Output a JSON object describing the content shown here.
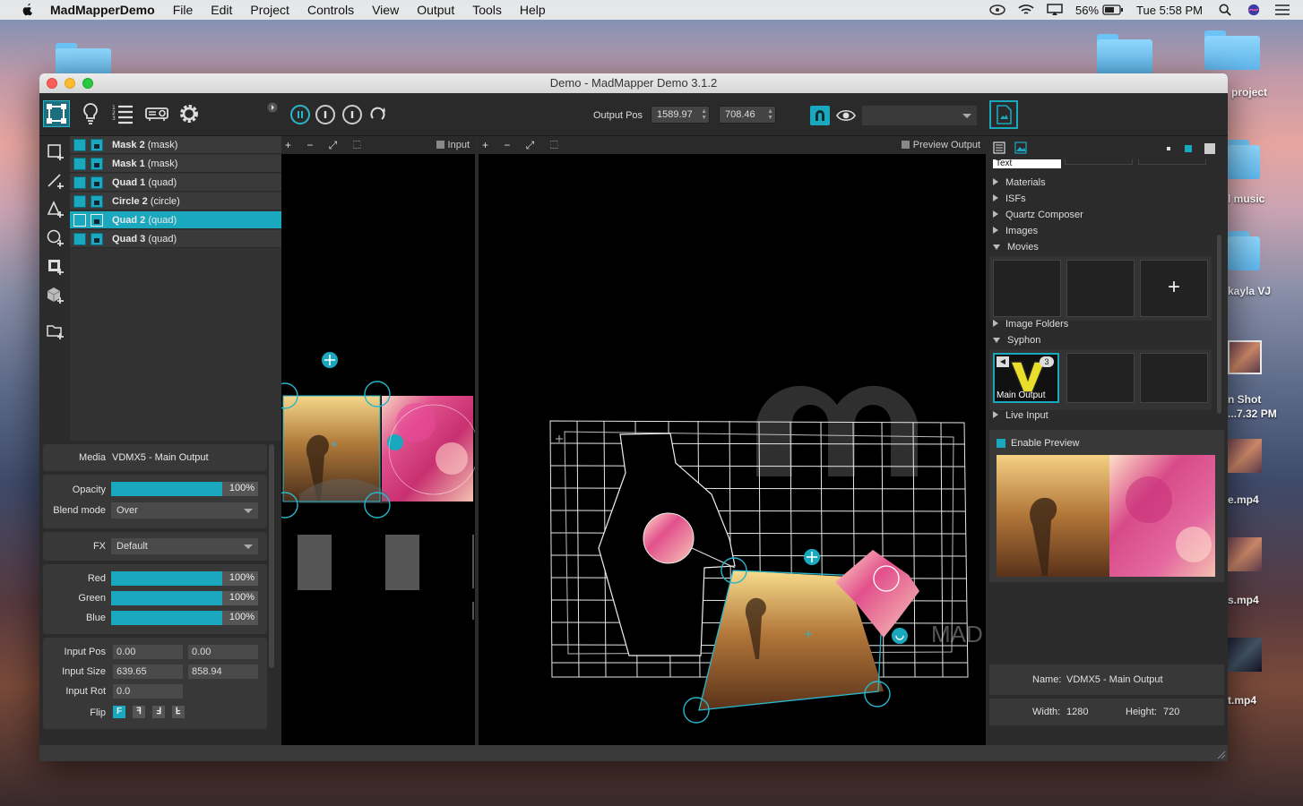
{
  "menubar": {
    "app_name": "MadMapperDemo",
    "items": [
      "File",
      "Edit",
      "Project",
      "Controls",
      "View",
      "Output",
      "Tools",
      "Help"
    ],
    "battery": "56%",
    "clock": "Tue 5:58 PM"
  },
  "desktop": {
    "labels": [
      "project",
      "l music",
      "kayla VJ",
      "n Shot",
      "...7.32 PM",
      "e.mp4",
      "s.mp4",
      "t.mp4"
    ]
  },
  "window": {
    "title": "Demo - MadMapper Demo 3.1.2"
  },
  "toolbar": {
    "output_pos_label": "Output Pos",
    "output_pos_x": "1589.97",
    "output_pos_y": "708.46",
    "output_select": ""
  },
  "surfaces": [
    {
      "name": "Mask 2",
      "type": "(mask)"
    },
    {
      "name": "Mask 1",
      "type": "(mask)"
    },
    {
      "name": "Quad 1",
      "type": "(quad)"
    },
    {
      "name": "Circle 2",
      "type": "(circle)"
    },
    {
      "name": "Quad 2",
      "type": "(quad)"
    },
    {
      "name": "Quad 3",
      "type": "(quad)"
    }
  ],
  "properties": {
    "media_label": "Media",
    "media_value": "VDMX5 - Main Output",
    "opacity_label": "Opacity",
    "opacity_pct": "100%",
    "opacity_level": 1.0,
    "blend_label": "Blend mode",
    "blend_value": "Over",
    "fx_label": "FX",
    "fx_value": "Default",
    "red_label": "Red",
    "red_pct": "100%",
    "green_label": "Green",
    "green_pct": "100%",
    "blue_label": "Blue",
    "blue_pct": "100%",
    "input_pos_label": "Input Pos",
    "input_pos_x": "0.00",
    "input_pos_y": "0.00",
    "input_size_label": "Input Size",
    "input_size_w": "639.65",
    "input_size_h": "858.94",
    "input_rot_label": "Input Rot",
    "input_rot": "0.0",
    "flip_label": "Flip",
    "flip_buttons": [
      "F",
      "ꟻ",
      "Ⅎ",
      "Ⅎ"
    ]
  },
  "input_view": {
    "label": "Input",
    "toolbar_glyphs": "+ − ⤢ ⬚"
  },
  "output_view": {
    "label": "Preview Output",
    "toolbar_glyphs": "+ − ⤢ ⬚",
    "watermark": "MAD"
  },
  "media_browser": {
    "search_text": "Text",
    "categories": [
      "Materials",
      "ISFs",
      "Quartz Composer",
      "Images",
      "Movies"
    ],
    "add_symbol": "+",
    "more_categories": [
      "Image Folders",
      "Syphon"
    ],
    "syphon_item_label": "Main Output",
    "syphon_badge": "3",
    "live_input": "Live Input",
    "enable_preview": "Enable Preview",
    "name_label": "Name:",
    "name_value": "VDMX5 - Main Output",
    "width_label": "Width:",
    "width_value": "1280",
    "height_label": "Height:",
    "height_value": "720"
  },
  "colors": {
    "accent": "#1aa8bf",
    "panel": "#2b2b2b",
    "row": "#3a3a3a"
  }
}
